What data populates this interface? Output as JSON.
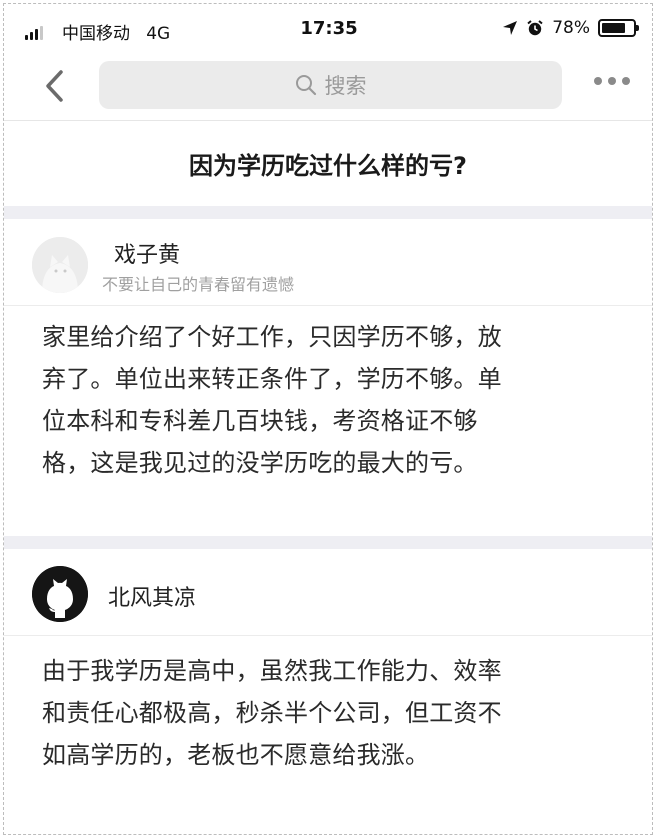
{
  "status_bar": {
    "carrier": "中国移动",
    "network": "4G",
    "time": "17:35",
    "battery": "78%",
    "battery_level": 0.78
  },
  "nav": {
    "search_placeholder": "搜索"
  },
  "question": {
    "title": "因为学历吃过什么样的亏?"
  },
  "answers": [
    {
      "author": "戏子黄",
      "bio": "不要让自己的青春留有遗憾",
      "lines": [
        "家里给介绍了个好工作，只因学历不够，放",
        "弃了。单位出来转正条件了，学历不够。单",
        "位本科和专科差几百块钱，考资格证不够",
        "格，这是我见过的没学历吃的最大的亏。"
      ]
    },
    {
      "author": "北风其凉",
      "lines": [
        "由于我学历是高中，虽然我工作能力、效率",
        "和责任心都极高，秒杀半个公司，但工资不",
        "如高学历的，老板也不愿意给我涨。"
      ]
    }
  ],
  "colors": {
    "background": "#ffffff",
    "separator": "#eeeef3",
    "search_bg": "#ebebeb",
    "muted_text": "#a0a0a0"
  }
}
